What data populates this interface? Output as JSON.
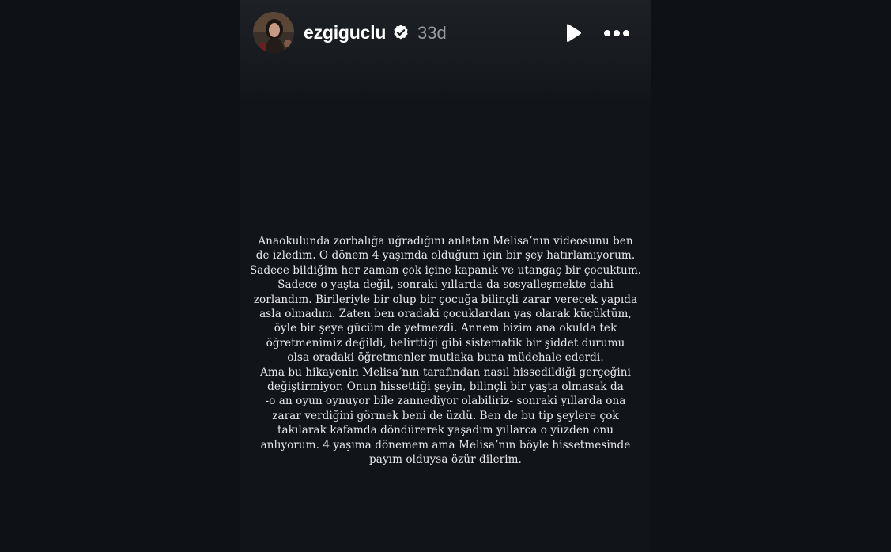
{
  "story": {
    "username": "ezgiguclu",
    "verified": true,
    "time_ago": "33d",
    "controls": {
      "play_icon": "play-icon",
      "more_icon": "more-options-icon"
    },
    "text_lines": [
      "Anaokulunda zorbalığa uğradığını anlatan Melisa’nın videosunu ben",
      "de izledim. O dönem 4 yaşımda olduğum için bir şey hatırlamıyorum.",
      "Sadece bildiğim her zaman çok içine kapanık ve utangaç bir çocuktum.",
      "Sadece o yaşta değil, sonraki yıllarda da sosyalleşmekte dahi",
      "zorlandım. Birileriyle bir olup bir çocuğa bilinçli zarar verecek yapıda",
      "asla olmadım. Zaten ben oradaki çocuklardan yaş olarak küçüktüm,",
      "öyle bir şeye gücüm de yetmezdi. Annem bizim ana okulda tek",
      "öğretmenimiz değildi, belirttiği gibi sistematik bir şiddet durumu",
      "olsa oradaki öğretmenler mutlaka buna müdehale ederdi.",
      "Ama bu hikayenin Melisa’nın tarafından nasıl hissedildiği gerçeğini",
      "değiştirmiyor. Onun hissettiği şeyin, bilinçli bir yaşta olmasak da",
      "-o an oyun oynuyor bile zannediyor olabiliriz- sonraki yıllarda ona",
      "zarar verdiğini görmek beni de üzdü. Ben de bu tip şeylere çok",
      "takılarak kafamda döndürerek yaşadım yıllarca o yüzden onu",
      "anlıyorum. 4 yaşıma dönemem ama Melisa’nın böyle hissetmesinde",
      "payım olduysa özür dilerim."
    ]
  },
  "colors": {
    "background": "#0e1116",
    "story_background": "#111419",
    "text": "#e8e8ea",
    "muted": "#9a9ca1",
    "verified_badge": "#ffffff"
  }
}
